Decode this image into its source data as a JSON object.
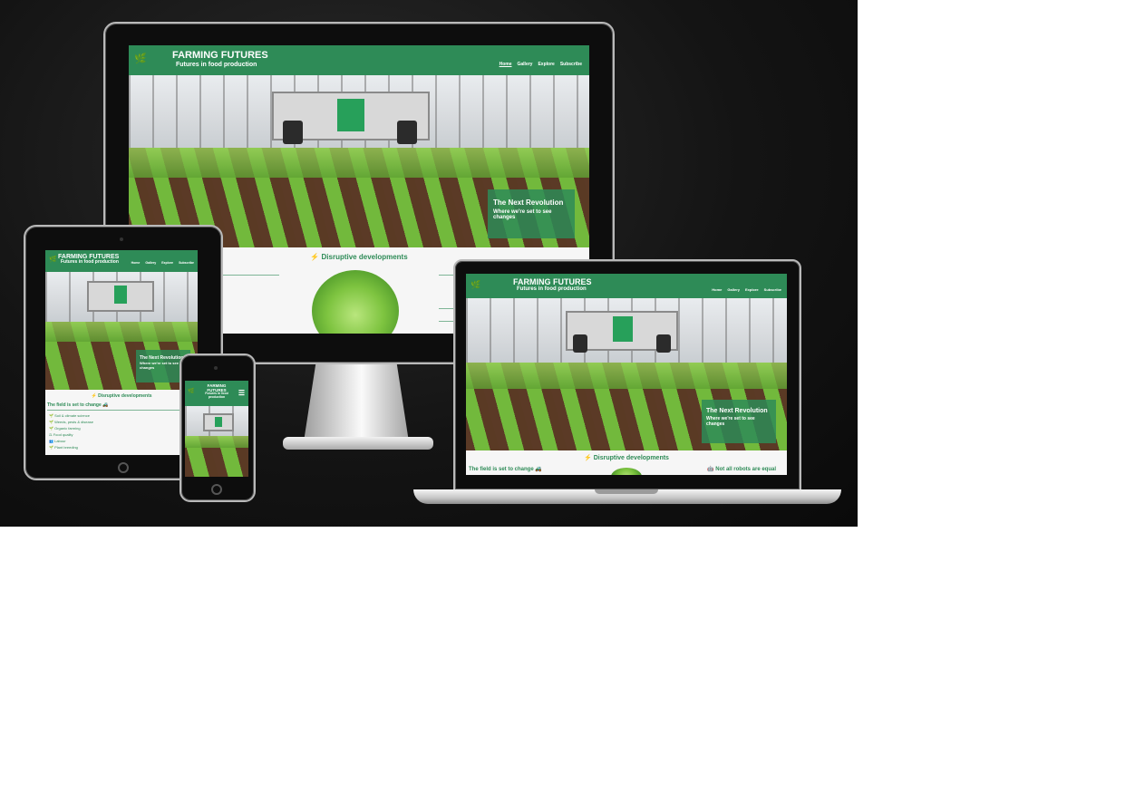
{
  "site": {
    "brand_title": "FARMING FUTURES",
    "brand_subtitle": "Futures in food production",
    "nav": [
      "Home",
      "Gallery",
      "Explore",
      "Subscribe"
    ],
    "hero_heading": "The Next Revolution",
    "hero_sub": "Where we're set to see changes",
    "section_title": "⚡ Disruptive developments",
    "field_heading": "The field is set to change 🚜",
    "robots_heading": "🤖 Not all robots are equal",
    "topics": [
      "🌱 Soil & climate science",
      "🌱 Weeds, pests & disease",
      "🌱 Organic farming",
      "⚖ Food quality",
      "👥 Labour",
      "🌱 Plant breeding"
    ],
    "menu_icon": "☰",
    "logo_icon": "🌿"
  },
  "colors": {
    "brand_green": "#2e8b57",
    "background": "#141414"
  }
}
